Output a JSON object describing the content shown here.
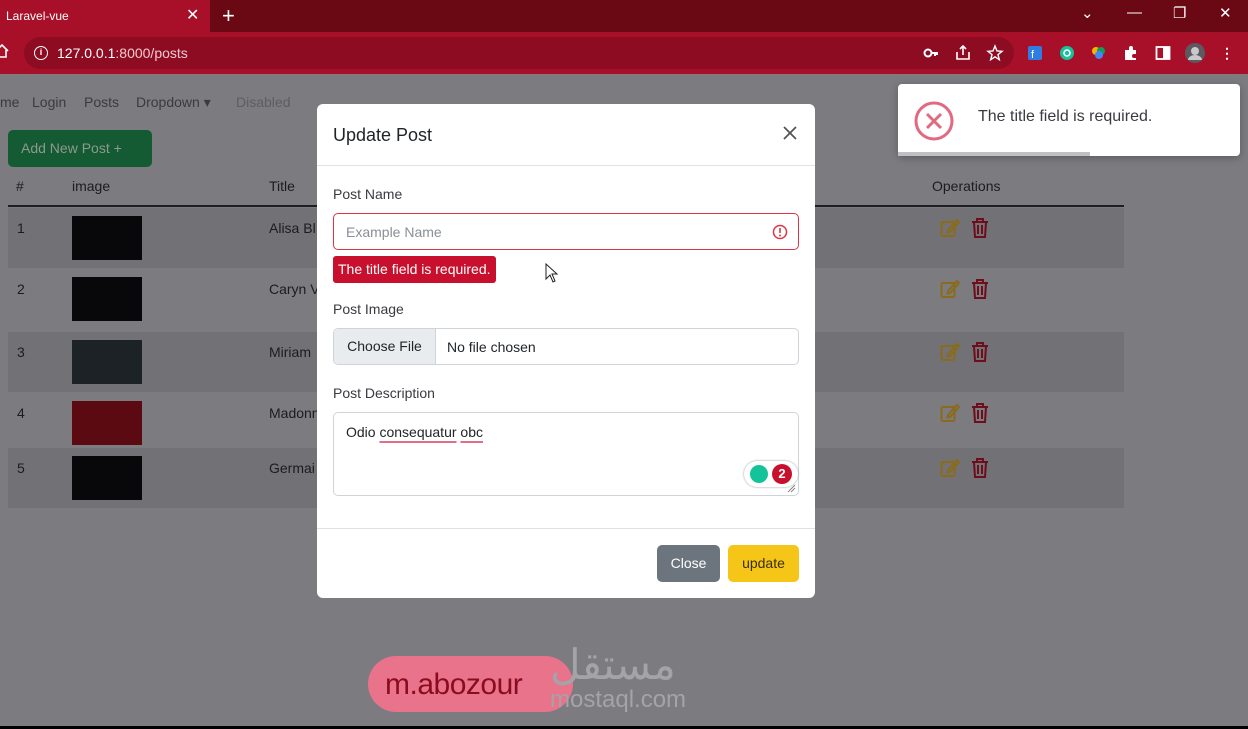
{
  "browser": {
    "tab_title": "Laravel-vue",
    "tab_close": "✕",
    "new_tab": "+",
    "url_host": "127.0.0.1",
    "url_rest": ":8000/posts",
    "window_controls": [
      "⌄",
      "—",
      "❐",
      "✕"
    ]
  },
  "nav": {
    "items": [
      "me",
      "Login",
      "Posts",
      "Dropdown ▾",
      "Disabled"
    ]
  },
  "toolbar": {
    "add_label": "Add New Post  +"
  },
  "table": {
    "headers": [
      "#",
      "image",
      "Title",
      "Operations"
    ],
    "rows": [
      {
        "num": "1",
        "title": "Alisa Bl"
      },
      {
        "num": "2",
        "title": "Caryn V"
      },
      {
        "num": "3",
        "title": "Miriam"
      },
      {
        "num": "4",
        "title": "Madonn"
      },
      {
        "num": "5",
        "title": "Germai"
      }
    ]
  },
  "modal": {
    "title": "Update Post",
    "post_name_label": "Post Name",
    "post_name_placeholder": "Example Name",
    "post_name_value": "",
    "error_message": "The title field is required.",
    "post_image_label": "Post Image",
    "choose_file_label": "Choose File",
    "file_status": "No file chosen",
    "post_description_label": "Post Description",
    "description_parts": [
      "Odio ",
      "consequatur",
      " ",
      "obc"
    ],
    "grammarly_count": "2",
    "close_label": "Close",
    "update_label": "update"
  },
  "toast": {
    "message": "The title field is required.",
    "progress": 0.56
  },
  "watermark": {
    "author": "m.abozour",
    "brand_arabic": "مستقل",
    "site": "mostaql.com"
  },
  "colors": {
    "chrome": "#a8102a",
    "danger": "#dc3545",
    "warning": "#f5c518",
    "success": "#198754",
    "secondary": "#6c757d"
  }
}
